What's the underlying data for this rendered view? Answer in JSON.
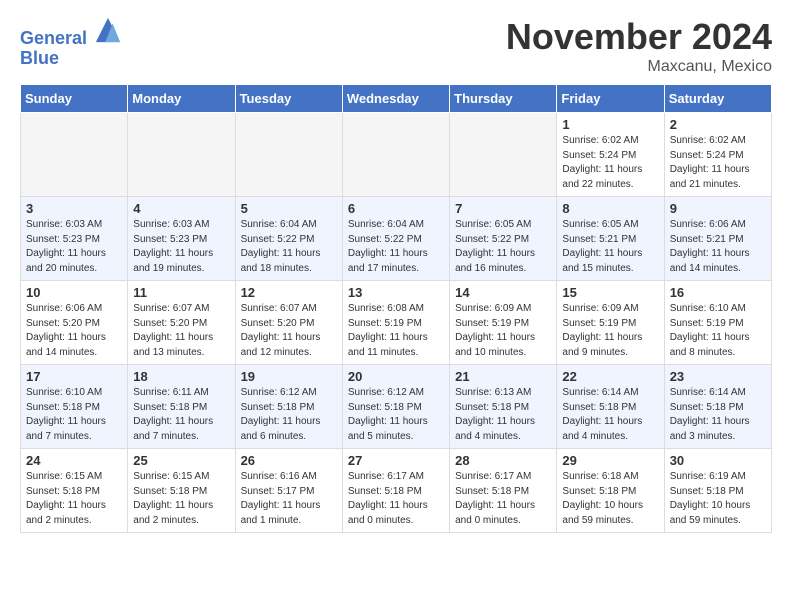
{
  "header": {
    "logo_general": "General",
    "logo_blue": "Blue",
    "month_title": "November 2024",
    "location": "Maxcanu, Mexico"
  },
  "days_of_week": [
    "Sunday",
    "Monday",
    "Tuesday",
    "Wednesday",
    "Thursday",
    "Friday",
    "Saturday"
  ],
  "weeks": [
    [
      {
        "day": "",
        "detail": "",
        "empty": true
      },
      {
        "day": "",
        "detail": "",
        "empty": true
      },
      {
        "day": "",
        "detail": "",
        "empty": true
      },
      {
        "day": "",
        "detail": "",
        "empty": true
      },
      {
        "day": "",
        "detail": "",
        "empty": true
      },
      {
        "day": "1",
        "detail": "Sunrise: 6:02 AM\nSunset: 5:24 PM\nDaylight: 11 hours\nand 22 minutes."
      },
      {
        "day": "2",
        "detail": "Sunrise: 6:02 AM\nSunset: 5:24 PM\nDaylight: 11 hours\nand 21 minutes."
      }
    ],
    [
      {
        "day": "3",
        "detail": "Sunrise: 6:03 AM\nSunset: 5:23 PM\nDaylight: 11 hours\nand 20 minutes."
      },
      {
        "day": "4",
        "detail": "Sunrise: 6:03 AM\nSunset: 5:23 PM\nDaylight: 11 hours\nand 19 minutes."
      },
      {
        "day": "5",
        "detail": "Sunrise: 6:04 AM\nSunset: 5:22 PM\nDaylight: 11 hours\nand 18 minutes."
      },
      {
        "day": "6",
        "detail": "Sunrise: 6:04 AM\nSunset: 5:22 PM\nDaylight: 11 hours\nand 17 minutes."
      },
      {
        "day": "7",
        "detail": "Sunrise: 6:05 AM\nSunset: 5:22 PM\nDaylight: 11 hours\nand 16 minutes."
      },
      {
        "day": "8",
        "detail": "Sunrise: 6:05 AM\nSunset: 5:21 PM\nDaylight: 11 hours\nand 15 minutes."
      },
      {
        "day": "9",
        "detail": "Sunrise: 6:06 AM\nSunset: 5:21 PM\nDaylight: 11 hours\nand 14 minutes."
      }
    ],
    [
      {
        "day": "10",
        "detail": "Sunrise: 6:06 AM\nSunset: 5:20 PM\nDaylight: 11 hours\nand 14 minutes."
      },
      {
        "day": "11",
        "detail": "Sunrise: 6:07 AM\nSunset: 5:20 PM\nDaylight: 11 hours\nand 13 minutes."
      },
      {
        "day": "12",
        "detail": "Sunrise: 6:07 AM\nSunset: 5:20 PM\nDaylight: 11 hours\nand 12 minutes."
      },
      {
        "day": "13",
        "detail": "Sunrise: 6:08 AM\nSunset: 5:19 PM\nDaylight: 11 hours\nand 11 minutes."
      },
      {
        "day": "14",
        "detail": "Sunrise: 6:09 AM\nSunset: 5:19 PM\nDaylight: 11 hours\nand 10 minutes."
      },
      {
        "day": "15",
        "detail": "Sunrise: 6:09 AM\nSunset: 5:19 PM\nDaylight: 11 hours\nand 9 minutes."
      },
      {
        "day": "16",
        "detail": "Sunrise: 6:10 AM\nSunset: 5:19 PM\nDaylight: 11 hours\nand 8 minutes."
      }
    ],
    [
      {
        "day": "17",
        "detail": "Sunrise: 6:10 AM\nSunset: 5:18 PM\nDaylight: 11 hours\nand 7 minutes."
      },
      {
        "day": "18",
        "detail": "Sunrise: 6:11 AM\nSunset: 5:18 PM\nDaylight: 11 hours\nand 7 minutes."
      },
      {
        "day": "19",
        "detail": "Sunrise: 6:12 AM\nSunset: 5:18 PM\nDaylight: 11 hours\nand 6 minutes."
      },
      {
        "day": "20",
        "detail": "Sunrise: 6:12 AM\nSunset: 5:18 PM\nDaylight: 11 hours\nand 5 minutes."
      },
      {
        "day": "21",
        "detail": "Sunrise: 6:13 AM\nSunset: 5:18 PM\nDaylight: 11 hours\nand 4 minutes."
      },
      {
        "day": "22",
        "detail": "Sunrise: 6:14 AM\nSunset: 5:18 PM\nDaylight: 11 hours\nand 4 minutes."
      },
      {
        "day": "23",
        "detail": "Sunrise: 6:14 AM\nSunset: 5:18 PM\nDaylight: 11 hours\nand 3 minutes."
      }
    ],
    [
      {
        "day": "24",
        "detail": "Sunrise: 6:15 AM\nSunset: 5:18 PM\nDaylight: 11 hours\nand 2 minutes."
      },
      {
        "day": "25",
        "detail": "Sunrise: 6:15 AM\nSunset: 5:18 PM\nDaylight: 11 hours\nand 2 minutes."
      },
      {
        "day": "26",
        "detail": "Sunrise: 6:16 AM\nSunset: 5:17 PM\nDaylight: 11 hours\nand 1 minute."
      },
      {
        "day": "27",
        "detail": "Sunrise: 6:17 AM\nSunset: 5:18 PM\nDaylight: 11 hours\nand 0 minutes."
      },
      {
        "day": "28",
        "detail": "Sunrise: 6:17 AM\nSunset: 5:18 PM\nDaylight: 11 hours\nand 0 minutes."
      },
      {
        "day": "29",
        "detail": "Sunrise: 6:18 AM\nSunset: 5:18 PM\nDaylight: 10 hours\nand 59 minutes."
      },
      {
        "day": "30",
        "detail": "Sunrise: 6:19 AM\nSunset: 5:18 PM\nDaylight: 10 hours\nand 59 minutes."
      }
    ]
  ]
}
